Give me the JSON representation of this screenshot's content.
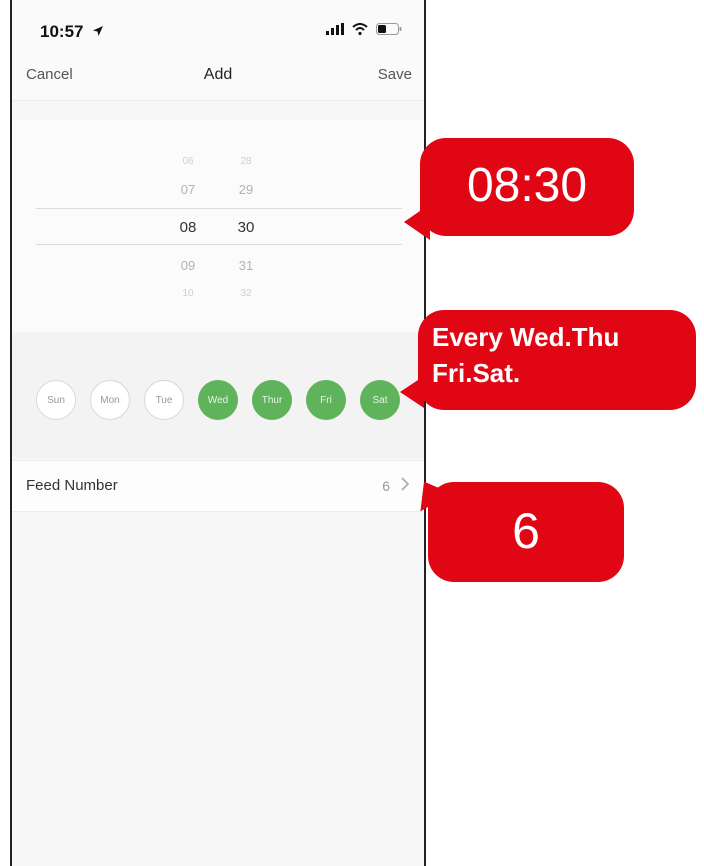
{
  "status_bar": {
    "time": "10:57"
  },
  "nav": {
    "cancel": "Cancel",
    "title": "Add",
    "save": "Save"
  },
  "picker": {
    "hours": [
      "06",
      "07",
      "08",
      "09",
      "10"
    ],
    "minutes": [
      "28",
      "29",
      "30",
      "31",
      "32"
    ],
    "selected_hour": "08",
    "selected_minute": "30"
  },
  "days": [
    {
      "label": "Sun",
      "selected": false
    },
    {
      "label": "Mon",
      "selected": false
    },
    {
      "label": "Tue",
      "selected": false
    },
    {
      "label": "Wed",
      "selected": true
    },
    {
      "label": "Thur",
      "selected": true
    },
    {
      "label": "Fri",
      "selected": true
    },
    {
      "label": "Sat",
      "selected": true
    }
  ],
  "feed": {
    "label": "Feed Number",
    "value": "6"
  },
  "callouts": {
    "time": "08:30",
    "repeat_line1": "Every Wed.Thu",
    "repeat_line2": "Fri.Sat.",
    "feed": "6"
  },
  "colors": {
    "accent_green": "#5fb35b",
    "callout_red": "#e10613"
  }
}
